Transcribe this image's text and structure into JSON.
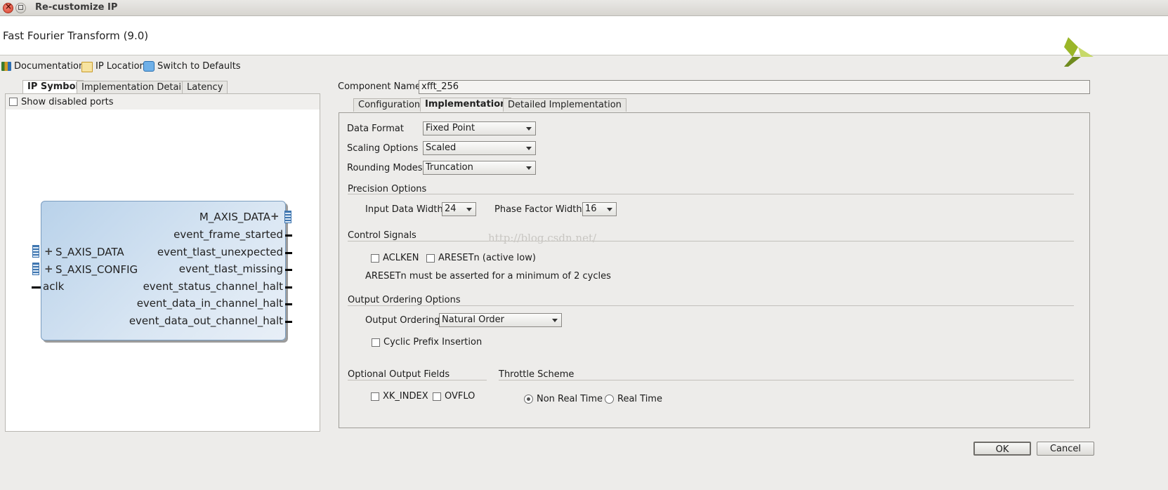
{
  "window": {
    "title": "Re-customize IP"
  },
  "header": {
    "ip_title": "Fast Fourier Transform (9.0)"
  },
  "toolbar": {
    "documentation": "Documentation",
    "ip_location": "IP Location",
    "switch_defaults": "Switch to Defaults"
  },
  "left": {
    "tabs": [
      "IP Symbol",
      "Implementation Details",
      "Latency"
    ],
    "show_disabled_ports": "Show disabled ports",
    "symbol": {
      "right_ports": [
        "M_AXIS_DATA",
        "event_frame_started",
        "event_tlast_unexpected",
        "event_tlast_missing",
        "event_status_channel_halt",
        "event_data_in_channel_halt",
        "event_data_out_channel_halt"
      ],
      "left_ports": [
        "S_AXIS_DATA",
        "S_AXIS_CONFIG",
        "aclk"
      ]
    }
  },
  "right": {
    "component_name_label": "Component Name",
    "component_name_value": "xfft_256",
    "tabs": [
      "Configuration",
      "Implementation",
      "Detailed Implementation"
    ],
    "data_format": {
      "label": "Data Format",
      "value": "Fixed Point"
    },
    "scaling_options": {
      "label": "Scaling Options",
      "value": "Scaled"
    },
    "rounding_modes": {
      "label": "Rounding Modes",
      "value": "Truncation"
    },
    "precision": {
      "title": "Precision Options",
      "input_width_label": "Input Data Width",
      "input_width_value": "24",
      "phase_width_label": "Phase Factor Width",
      "phase_width_value": "16"
    },
    "control": {
      "title": "Control Signals",
      "aclken": "ACLKEN",
      "aresetn": "ARESETn (active low)",
      "note": "ARESETn must be asserted for a minimum of 2 cycles"
    },
    "watermark": "http://blog.csdn.net/",
    "output_ordering": {
      "title": "Output Ordering Options",
      "label": "Output Ordering",
      "value": "Natural Order",
      "cyclic_prefix": "Cyclic Prefix Insertion"
    },
    "optional_fields": {
      "title": "Optional Output Fields",
      "xk_index": "XK_INDEX",
      "ovflo": "OVFLO"
    },
    "throttle": {
      "title": "Throttle Scheme",
      "non_real_time": "Non Real Time",
      "real_time": "Real Time"
    }
  },
  "footer": {
    "ok": "OK",
    "cancel": "Cancel"
  }
}
